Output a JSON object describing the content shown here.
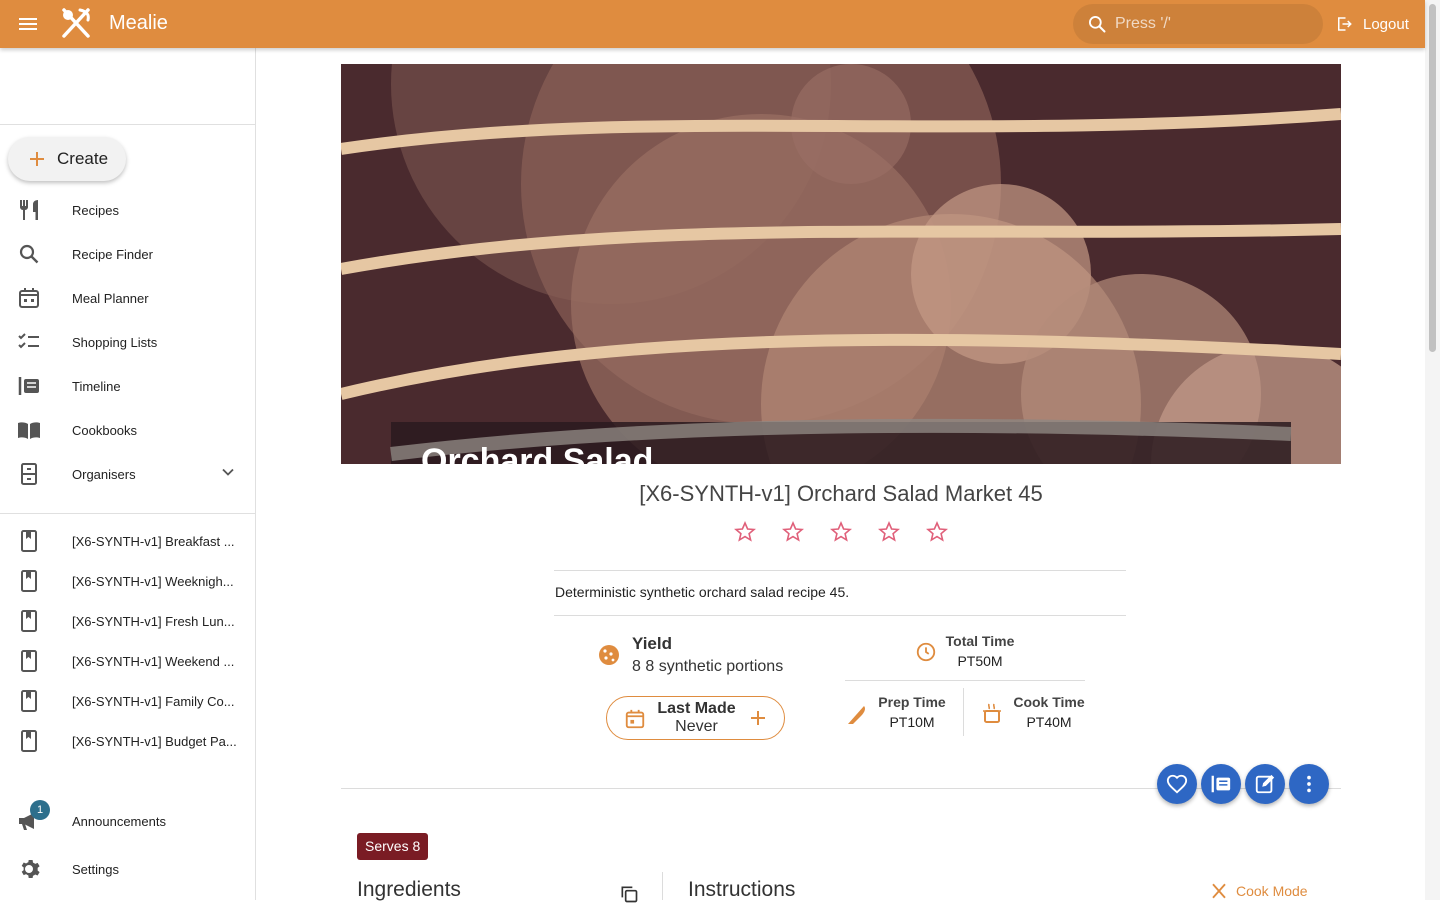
{
  "app": {
    "title": "Mealie",
    "logout_label": "Logout",
    "search_placeholder": "Press '/'"
  },
  "colors": {
    "primary": "#df8c3f",
    "accent_fab": "#2e67c4",
    "serves_badge": "#7a1c24",
    "star": "#e0607a"
  },
  "sidebar": {
    "create_label": "Create",
    "nav": [
      {
        "label": "Recipes",
        "icon": "fork-knife-icon"
      },
      {
        "label": "Recipe Finder",
        "icon": "search-icon"
      },
      {
        "label": "Meal Planner",
        "icon": "calendar-icon"
      },
      {
        "label": "Shopping Lists",
        "icon": "checklist-icon"
      },
      {
        "label": "Timeline",
        "icon": "timeline-icon"
      },
      {
        "label": "Cookbooks",
        "icon": "book-open-icon"
      },
      {
        "label": "Organisers",
        "icon": "cabinet-icon"
      }
    ],
    "cookbooks": [
      "[X6-SYNTH-v1] Breakfast ...",
      "[X6-SYNTH-v1] Weeknigh...",
      "[X6-SYNTH-v1] Fresh Lun...",
      "[X6-SYNTH-v1] Weekend ...",
      "[X6-SYNTH-v1] Family Co...",
      "[X6-SYNTH-v1] Budget Pa..."
    ],
    "announcements_label": "Announcements",
    "announcements_count": "1",
    "settings_label": "Settings"
  },
  "recipe": {
    "hero_text": "Orchard Salad",
    "title": "[X6-SYNTH-v1] Orchard Salad Market 45",
    "rating": 0,
    "rating_max": 5,
    "description": "Deterministic synthetic orchard salad recipe 45.",
    "yield_label": "Yield",
    "yield_value": "8 8 synthetic portions",
    "last_made_label": "Last Made",
    "last_made_value": "Never",
    "total_time_label": "Total Time",
    "total_time_value": "PT50M",
    "prep_time_label": "Prep Time",
    "prep_time_value": "PT10M",
    "cook_time_label": "Cook Time",
    "cook_time_value": "PT40M",
    "serves_label": "Serves 8",
    "ingredients_label": "Ingredients",
    "instructions_label": "Instructions",
    "cook_mode_label": "Cook Mode"
  }
}
